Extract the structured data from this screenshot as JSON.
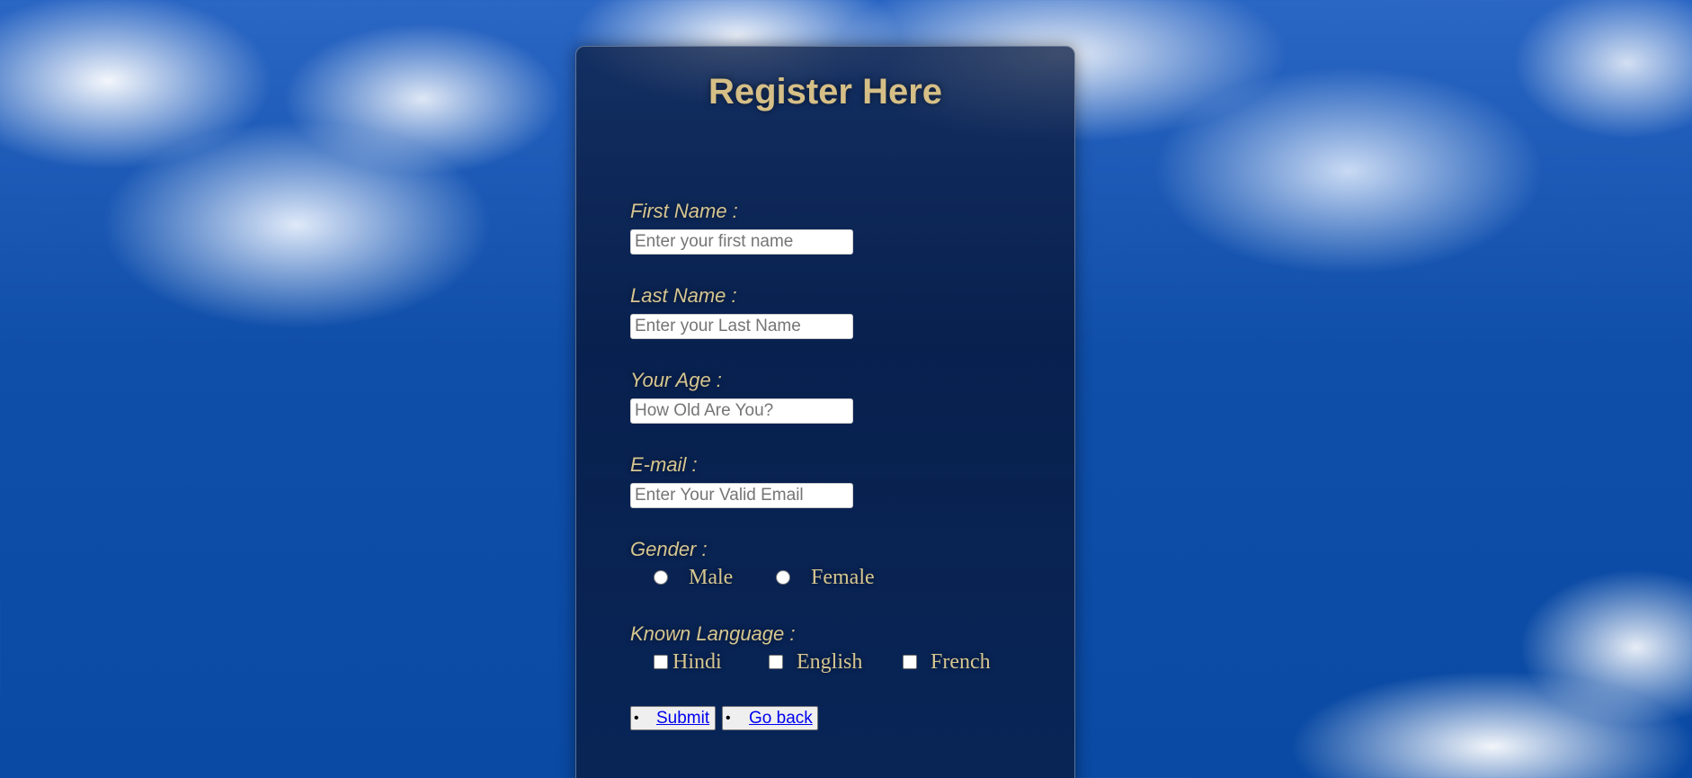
{
  "form": {
    "title": "Register Here",
    "fields": [
      {
        "label": "First Name :",
        "placeholder": "Enter your first name"
      },
      {
        "label": "Last Name :",
        "placeholder": "Enter your Last Name"
      },
      {
        "label": "Your Age :",
        "placeholder": "How Old Are You?"
      },
      {
        "label": "E-mail :",
        "placeholder": "Enter Your Valid Email"
      }
    ],
    "gender": {
      "label": "Gender :",
      "options": [
        "Male",
        "Female"
      ]
    },
    "languages": {
      "label": "Known Language :",
      "options": [
        "Hindi",
        "English",
        "French"
      ]
    },
    "buttons": {
      "submit": "Submit",
      "go_back": "Go back"
    }
  },
  "colors": {
    "label_text": "#d6c690",
    "title_text": "#d6bf86",
    "link": "#0000ee",
    "panel": "#0e2148"
  }
}
